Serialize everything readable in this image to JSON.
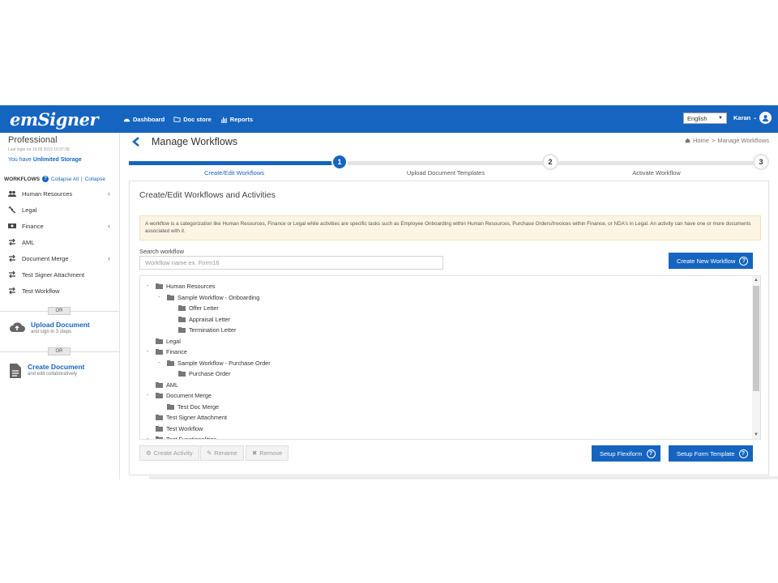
{
  "topbar": {
    "logo": "emSigner",
    "nav": [
      {
        "label": "Dashboard",
        "icon": "dashboard-icon"
      },
      {
        "label": "Doc store",
        "icon": "folder-icon"
      },
      {
        "label": "Reports",
        "icon": "bar-chart-icon"
      }
    ],
    "language": "English",
    "user": "Karan",
    "colors": {
      "brand": "#1565c0"
    }
  },
  "sidebar": {
    "plan": "Professional",
    "last_login": "Last login on 19.09.2019 10:37:38",
    "storage_prefix": "You have ",
    "storage_value": "Unlimited Storage",
    "workflows_title": "WORKFLOWS",
    "collapse_all": "Collapse All",
    "separator": "|",
    "collapse": "Collapse",
    "items": [
      {
        "label": "Human Resources",
        "icon": "users-icon",
        "has_children": true
      },
      {
        "label": "Legal",
        "icon": "gavel-icon",
        "has_children": false
      },
      {
        "label": "Finance",
        "icon": "money-icon",
        "has_children": true
      },
      {
        "label": "AML",
        "icon": "workflow-icon",
        "has_children": false
      },
      {
        "label": "Document Merge",
        "icon": "workflow-icon",
        "has_children": true
      },
      {
        "label": "Test Signer Attachment",
        "icon": "workflow-icon",
        "has_children": false
      },
      {
        "label": "Test Workflow",
        "icon": "workflow-icon",
        "has_children": false
      }
    ],
    "or_label": "OR",
    "upload": {
      "title": "Upload Document",
      "subtitle": "and sign in 3 steps"
    },
    "create": {
      "title": "Create Document",
      "subtitle": "and edit collaboratively"
    }
  },
  "header": {
    "title": "Manage Workflows",
    "breadcrumb_home": "Home",
    "breadcrumb_sep": ">",
    "breadcrumb_current": "Manage Workflows"
  },
  "stepper": {
    "steps": [
      {
        "number": "1",
        "label": "Create/Edit Workflows",
        "active": true
      },
      {
        "number": "2",
        "label": "Upload Document Templates",
        "active": false
      },
      {
        "number": "3",
        "label": "Activate Workflow",
        "active": false
      }
    ]
  },
  "panel": {
    "title": "Create/Edit Workflows and Activities",
    "info": "A workflow is a categorization like Human Resources, Finance or Legal while activities are specific tasks such as Employee Onboarding within Human Resources, Purchase Orders/Invoices within Finance, or NDA's in Legal. An activity can have one or more documents associated with it.",
    "search_label": "Search workflow",
    "search_placeholder": "Workflow name ex. Form16",
    "create_button": "Create New Workflow",
    "help_glyph": "?",
    "tree": [
      {
        "label": "Human Resources",
        "level": 0,
        "expander": "-"
      },
      {
        "label": "Sample Workflow - Onboarding",
        "level": 1,
        "expander": "-"
      },
      {
        "label": "Offer Letter",
        "level": 2,
        "expander": ""
      },
      {
        "label": "Appraisal Letter",
        "level": 2,
        "expander": ""
      },
      {
        "label": "Termination Letter",
        "level": 2,
        "expander": ""
      },
      {
        "label": "Legal",
        "level": 0,
        "expander": ""
      },
      {
        "label": "Finance",
        "level": 0,
        "expander": "-"
      },
      {
        "label": "Sample Workflow - Purchase Order",
        "level": 1,
        "expander": "-"
      },
      {
        "label": "Purchase Order",
        "level": 2,
        "expander": ""
      },
      {
        "label": "AML",
        "level": 0,
        "expander": ""
      },
      {
        "label": "Document Merge",
        "level": 0,
        "expander": "-"
      },
      {
        "label": "Test Doc Merge",
        "level": 1,
        "expander": ""
      },
      {
        "label": "Test Signer Attachment",
        "level": 0,
        "expander": ""
      },
      {
        "label": "Test Workflow",
        "level": 0,
        "expander": ""
      },
      {
        "label": "Test Functionalities",
        "level": 0,
        "expander": "-"
      }
    ],
    "actions": {
      "create_activity": "Create Activity",
      "rename": "Rename",
      "remove": "Remove",
      "setup_flexiform": "Setup Flexiform",
      "setup_form_template": "Setup Form Template"
    }
  }
}
